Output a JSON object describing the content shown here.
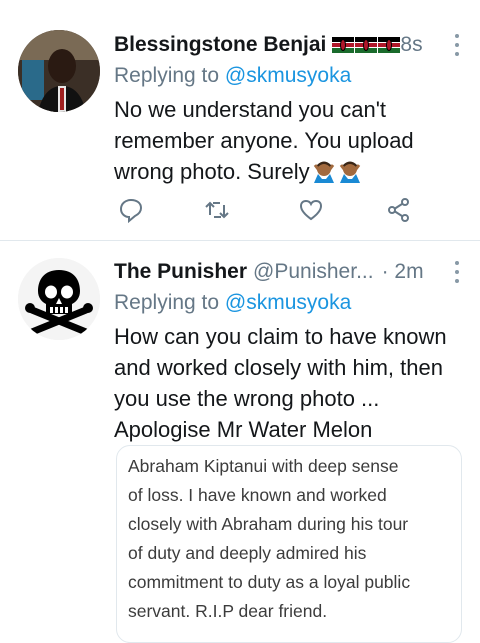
{
  "tweets": [
    {
      "name": "Blessingstone Benjai",
      "flag_count": 3,
      "time": "8s",
      "replying_label": "Replying to",
      "reply_to": "@skmusyoka",
      "text": "No we understand you can't remember anyone. You upload wrong photo. Surely",
      "emoji": [
        "person-gesturing-no-icon",
        "person-gesturing-no-icon"
      ],
      "actions": [
        "reply-icon",
        "retweet-icon",
        "like-icon",
        "share-icon"
      ]
    },
    {
      "name": "The Punisher",
      "handle": "@Punisher...",
      "time": "· 2m",
      "replying_label": "Replying to",
      "reply_to": "@skmusyoka",
      "text_lines": [
        "How can you claim to have known",
        "and worked closely with him, then",
        "you use the wrong photo ...",
        "Apologise Mr Water Melon"
      ],
      "quote_lines": [
        "Abraham Kiptanui with deep sense",
        "of loss. I have known and worked",
        "closely with Abraham during his tour",
        "of duty and deeply admired his",
        "commitment to duty as a loyal public",
        "servant. R.I.P dear friend."
      ]
    }
  ],
  "colors": {
    "link": "#1b95e0",
    "secondary": "#657786",
    "divider": "#e1e8ed"
  }
}
